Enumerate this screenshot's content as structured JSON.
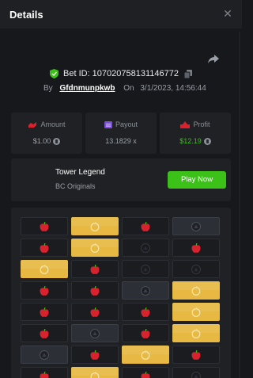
{
  "header": {
    "title": "Details"
  },
  "bet": {
    "id_label": "Bet ID: 107020758131146772",
    "by_label": "By",
    "user": "Gfdnmunpkwb",
    "on_label": "On",
    "datetime": "3/1/2023, 14:56:44"
  },
  "stats": {
    "amount": {
      "label": "Amount",
      "value": "$1.00"
    },
    "payout": {
      "label": "Payout",
      "value": "13.1829 x"
    },
    "profit": {
      "label": "Profit",
      "value": "$12.19"
    }
  },
  "game": {
    "name": "Tower Legend",
    "provider": "BC Originals",
    "play_label": "Play Now"
  },
  "colors": {
    "accent": "#3bc117",
    "egg_gold": "#e7b943",
    "apple_red": "#d8232f"
  },
  "board": {
    "columns": 4,
    "rows": [
      [
        "apple",
        "egg",
        "apple",
        "stone"
      ],
      [
        "apple",
        "egg",
        "empty",
        "apple"
      ],
      [
        "egg",
        "apple",
        "empty",
        "empty"
      ],
      [
        "apple",
        "apple",
        "stone",
        "egg"
      ],
      [
        "apple",
        "apple",
        "apple",
        "egg"
      ],
      [
        "apple",
        "stone",
        "apple",
        "egg"
      ],
      [
        "stone",
        "apple",
        "egg",
        "apple"
      ],
      [
        "apple",
        "egg",
        "apple",
        "empty"
      ]
    ]
  }
}
